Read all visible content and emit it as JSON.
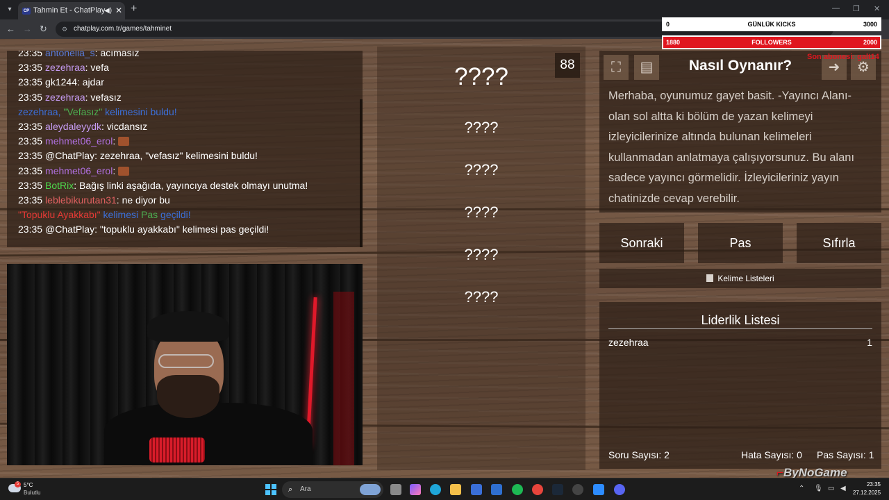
{
  "browser": {
    "tab_title": "Tahmin Et - ChatPlay",
    "tab_favicon": "CP",
    "url": "chatplay.com.tr/games/tahminet"
  },
  "chat": {
    "messages": [
      {
        "time": "23:35",
        "user": "antonella_s",
        "user_color": "#5a7bd8",
        "text": ": acımasız"
      },
      {
        "time": "23:35",
        "user": "zezehraa",
        "user_color": "#c59bf2",
        "text": ": vefa"
      },
      {
        "time": "23:35",
        "user": "gk1244",
        "user_color": "#ffffff",
        "text": ": ajdar"
      },
      {
        "time": "23:35",
        "user": "zezehraa",
        "user_color": "#c59bf2",
        "text": ": vefasız"
      },
      {
        "time": "23:35",
        "user": "aleydaleyydk",
        "user_color": "#c59bf2",
        "text": ": vicdansız"
      },
      {
        "time": "23:35",
        "user": "mehmet06_erol",
        "user_color": "#b070e0",
        "text": ":"
      },
      {
        "time": "23:35",
        "user": "@ChatPlay",
        "user_color": "#ffffff",
        "text": ": zezehraa, \"vefasız\" kelimesini buldu!"
      },
      {
        "time": "23:35",
        "user": "mehmet06_erol",
        "user_color": "#b070e0",
        "text": ":"
      },
      {
        "time": "23:35",
        "user": "BotRix",
        "user_color": "#4dd84d",
        "text": ": Bağış linki aşağıda, yayıncıya destek olmayı unutma!"
      },
      {
        "time": "23:35",
        "user": "leblebikurutan31",
        "user_color": "#e06060",
        "text": ": ne diyor bu"
      },
      {
        "time": "23:35",
        "user": "@ChatPlay",
        "user_color": "#ffffff",
        "text": ": \"topuklu ayakkabı\" kelimesi pas geçildi!"
      }
    ],
    "system_found": {
      "user": "zezehraa, ",
      "word": "\"Vefasız\"",
      "suffix": " kelimesini buldu!"
    },
    "system_pass": {
      "word": "\"Topuklu Ayakkabı\"",
      "mid": " kelimesi ",
      "pas": "Pas",
      "suffix": " geçildi!"
    }
  },
  "words_panel": {
    "counter": "88",
    "words": [
      "????",
      "????",
      "????",
      "????",
      "????",
      "????"
    ]
  },
  "howto": {
    "title": "Nasıl Oynanır?",
    "text": "Merhaba, oyunumuz gayet basit. -Yayıncı Alanı- olan sol altta ki bölüm de yazan kelimeyi izleyicilerinize altında bulunan kelimeleri kullanmadan anlatmaya çalışıyorsunuz. Bu alanı sadece yayıncı görmelidir. İzleyicileriniz yayın chatinizde cevap verebilir.",
    "icons": [
      "fullscreen-icon",
      "book-icon",
      "exit-icon",
      "gear-icon"
    ]
  },
  "buttons": {
    "next": "Sonraki",
    "pass": "Pas",
    "reset": "Sıfırla"
  },
  "word_lists": {
    "label": "Kelime Listeleri"
  },
  "leaderboard": {
    "title": "Liderlik Listesi",
    "rows": [
      {
        "name": "zezehraa",
        "score": "1"
      }
    ],
    "stats": {
      "questions_label": "Soru Sayısı:",
      "questions_value": "2",
      "errors_label": "Hata Sayısı:",
      "errors_value": "0",
      "passes_label": "Pas Sayısı:",
      "passes_value": "1"
    }
  },
  "overlay": {
    "kicks": {
      "current": "0",
      "label": "GÜNLÜK KICKS",
      "goal": "3000"
    },
    "followers": {
      "current": "1880",
      "label": "FOLLOWERS",
      "goal": "2000"
    },
    "red_text": "Son abonesi: galt14",
    "watermark": "ByNoGame"
  },
  "taskbar": {
    "weather_temp": "5°C",
    "weather_desc": "Bulutlu",
    "weather_badge": "5",
    "search_placeholder": "Ara",
    "time": "23:35",
    "date": "27.12.2025"
  }
}
